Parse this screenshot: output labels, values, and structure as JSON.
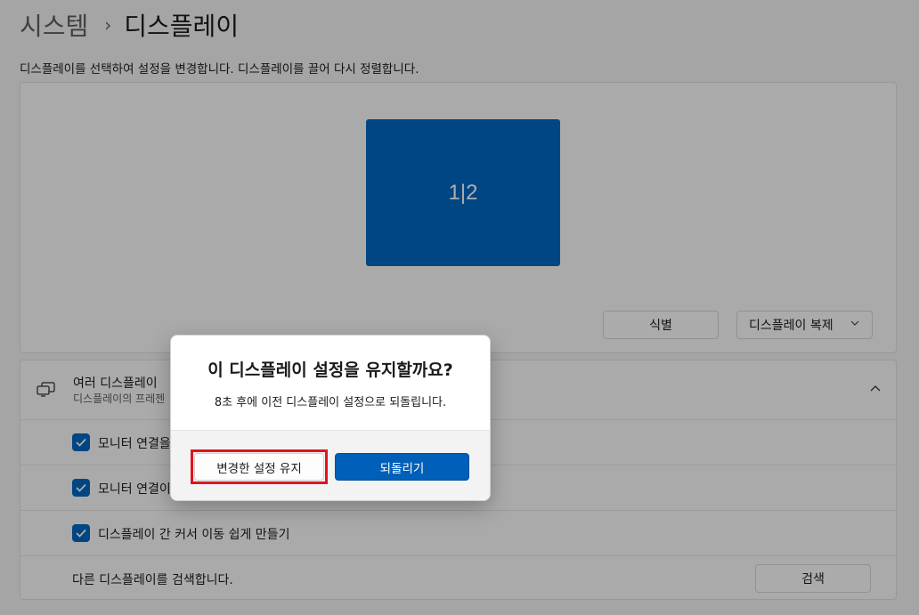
{
  "breadcrumb": {
    "parent": "시스템",
    "separator": "›",
    "current": "디스플레이"
  },
  "description": "디스플레이를 선택하여 설정을 변경합니다. 디스플레이를 끌어 다시 정렬합니다.",
  "arrangement": {
    "monitor_label": "1|2",
    "identify_label": "식별",
    "mode_select_value": "디스플레이 복제"
  },
  "multiple_displays": {
    "title": "여러 디스플레이",
    "subtitle": "디스플레이의 프레젠",
    "options": [
      {
        "label": "모니터 연결을",
        "checked": true
      },
      {
        "label": "모니터 연결이",
        "checked": true
      },
      {
        "label": "디스플레이 간 커서 이동 쉽게 만들기",
        "checked": true
      }
    ],
    "detect_text": "다른 디스플레이를 검색합니다.",
    "detect_button": "검색"
  },
  "dialog": {
    "title": "이 디스플레이 설정을 유지할까요?",
    "message": "8초 후에 이전 디스플레이 설정으로 되돌립니다.",
    "keep_button": "변경한 설정 유지",
    "revert_button": "되돌리기"
  },
  "colors": {
    "accent": "#0067c0",
    "highlight": "#e0141e"
  },
  "icons": {
    "multi_display": "multi-monitor-icon",
    "collapse": "chevron-up-icon",
    "dropdown": "chevron-down-icon",
    "check": "checkmark-icon"
  }
}
